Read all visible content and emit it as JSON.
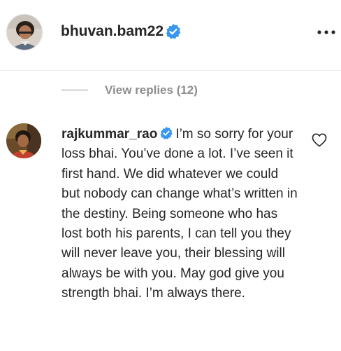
{
  "post_header": {
    "username": "bhuvan.bam22",
    "verified": true,
    "more_icon": "more-horizontal-icon"
  },
  "replies": {
    "view_replies_label": "View replies (12)"
  },
  "comment": {
    "author": "rajkummar_rao",
    "verified": true,
    "text": "I’m so sorry for your loss bhai. You’ve done a lot. I’ve seen it first hand. We did whatever we could but nobody can change what’s written in the destiny. Being someone who has lost both his parents, I can tell you they will never leave you, their blessing will always be with you. May god give you strength bhai. I’m always there.",
    "like_icon": "heart-outline-icon"
  },
  "colors": {
    "verified_blue": "#3897f0",
    "text_primary": "#262626",
    "text_secondary": "#8e8e8e"
  }
}
